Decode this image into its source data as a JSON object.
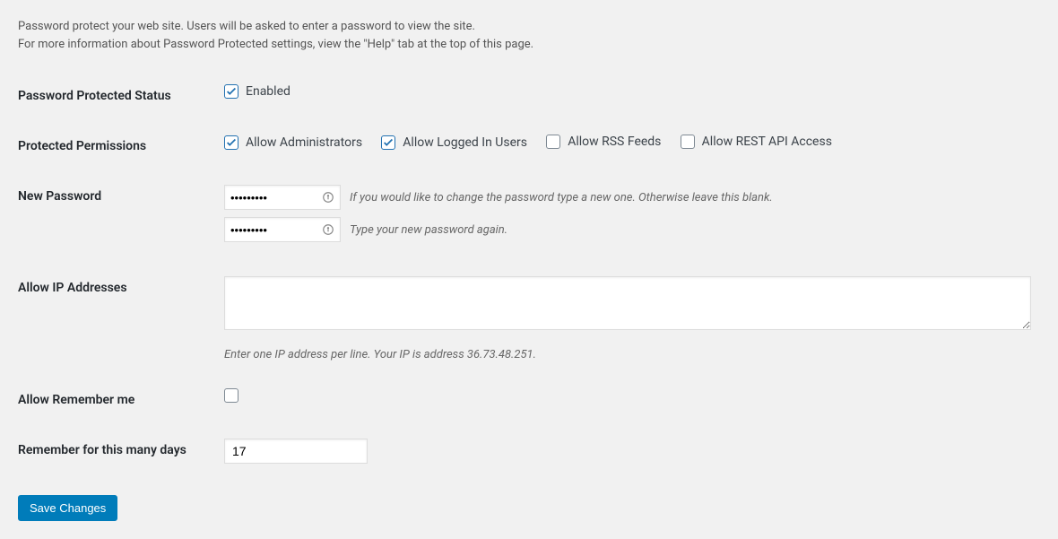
{
  "intro": {
    "line1": "Password protect your web site. Users will be asked to enter a password to view the site.",
    "line2": "For more information about Password Protected settings, view the \"Help\" tab at the top of this page."
  },
  "fields": {
    "status": {
      "label": "Password Protected Status",
      "enabled_label": "Enabled",
      "enabled_checked": true
    },
    "permissions": {
      "label": "Protected Permissions",
      "options": [
        {
          "label": "Allow Administrators",
          "checked": true
        },
        {
          "label": "Allow Logged In Users",
          "checked": true
        },
        {
          "label": "Allow RSS Feeds",
          "checked": false
        },
        {
          "label": "Allow REST API Access",
          "checked": false
        }
      ]
    },
    "new_password": {
      "label": "New Password",
      "value1": "•••••••••",
      "desc1": "If you would like to change the password type a new one. Otherwise leave this blank.",
      "value2": "•••••••••",
      "desc2": "Type your new password again."
    },
    "allow_ip": {
      "label": "Allow IP Addresses",
      "value": "",
      "desc": "Enter one IP address per line. Your IP is address 36.73.48.251."
    },
    "remember_me": {
      "label": "Allow Remember me",
      "checked": false
    },
    "remember_days": {
      "label": "Remember for this many days",
      "value": "17"
    }
  },
  "submit_label": "Save Changes"
}
